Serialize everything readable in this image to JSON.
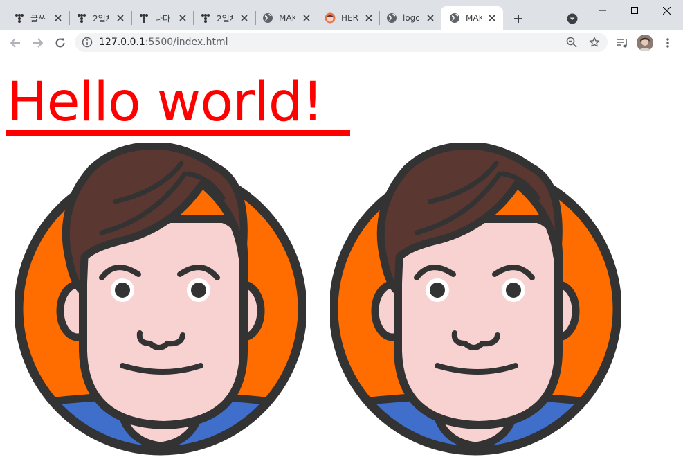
{
  "browser": {
    "tabs": [
      {
        "title": "글쓰",
        "favicon": "tistory-icon",
        "active": false
      },
      {
        "title": "2일차",
        "favicon": "tistory-icon",
        "active": false
      },
      {
        "title": "나다",
        "favicon": "tistory-icon",
        "active": false
      },
      {
        "title": "2일차",
        "favicon": "tistory-icon",
        "active": false
      },
      {
        "title": "MAK",
        "favicon": "globe-icon",
        "active": false
      },
      {
        "title": "HER",
        "favicon": "avatar-icon",
        "active": false
      },
      {
        "title": "logo",
        "favicon": "globe-icon",
        "active": false
      },
      {
        "title": "MAK",
        "favicon": "globe-icon",
        "active": true
      }
    ],
    "url_host": "127.0.0.1",
    "url_path": ":5500/index.html"
  },
  "page": {
    "heading": "Hello world!",
    "heading_color": "#ff0000",
    "image_alt": "avatar"
  },
  "colors": {
    "face_bg": "#ff6d00",
    "hair": "#5a3730",
    "skin": "#f7d2d1",
    "shirt": "#3f6ecb",
    "outline": "#333333"
  }
}
